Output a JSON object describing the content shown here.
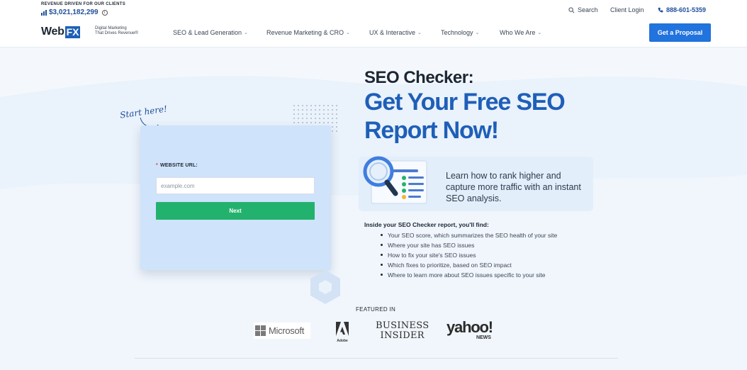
{
  "header": {
    "revenue_caption": "REVENUE DRIVEN FOR OUR CLIENTS",
    "revenue_amount": "$3,021,182,299",
    "search_label": "Search",
    "client_login_label": "Client Login",
    "phone": "888-601-5359",
    "logo_web": "Web",
    "logo_fx": "FX",
    "logo_tagline_1": "Digital Marketing",
    "logo_tagline_2": "That Drives Revenue®",
    "nav": [
      {
        "label": "SEO & Lead Generation"
      },
      {
        "label": "Revenue Marketing & CRO"
      },
      {
        "label": "UX & Interactive"
      },
      {
        "label": "Technology"
      },
      {
        "label": "Who We Are"
      }
    ],
    "cta_label": "Get a Proposal"
  },
  "form": {
    "start_here": "Start here!",
    "required_mark": "*",
    "url_label": "WEBSITE URL:",
    "url_placeholder": "example.com",
    "url_value": "",
    "submit_label": "Next"
  },
  "hero": {
    "heading_small": "SEO Checker:",
    "heading_big": "Get Your Free SEO Report Now!",
    "promo_text": "Learn how to rank higher and capture more traffic with an instant SEO analysis.",
    "find_title": "Inside your SEO Checker report, you'll find:",
    "find_items": [
      "Your SEO score, which summarizes the SEO health of your site",
      "Where your site has SEO issues",
      "How to fix your site's SEO issues",
      "Which fixes to prioritize, based on SEO impact",
      "Where to learn more about SEO issues specific to your site"
    ]
  },
  "featured": {
    "title": "FEATURED IN",
    "logos": {
      "microsoft": "Microsoft",
      "adobe": "Adobe",
      "business_insider_1": "BUSINESS",
      "business_insider_2": "INSIDER",
      "yahoo": "yahoo!",
      "yahoo_sub": "NEWS"
    }
  },
  "colors": {
    "brand_blue": "#1e5fb8",
    "cta_blue": "#2173de",
    "next_green": "#23b26d",
    "form_bg": "#cfe3fb"
  },
  "icons": [
    "bar-chart-icon",
    "info-icon",
    "search-icon",
    "phone-icon",
    "chevron-down-icon",
    "magnifier-illustration",
    "hexagon-decoration"
  ]
}
